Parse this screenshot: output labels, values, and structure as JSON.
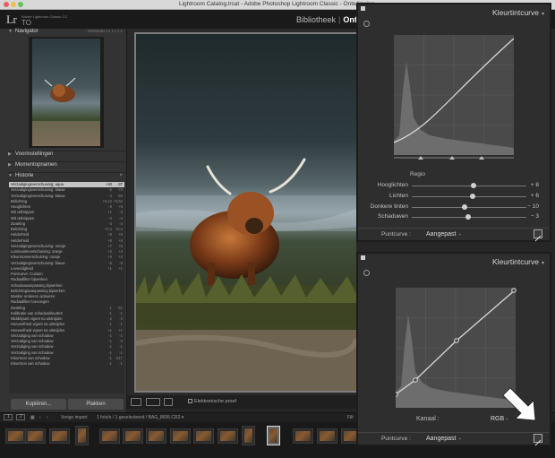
{
  "window": {
    "title": "Lightroom Catalog.lrcat - Adobe Photoshop Lightroom Classic - Ontwikkelen"
  },
  "identity": {
    "logo": "Lr",
    "subtitle": "Adobe Lightroom Classic CC",
    "user": "TO"
  },
  "modules": {
    "library": "Bibliotheek",
    "separator": "|",
    "active": "Ont"
  },
  "left_panel": {
    "navigator": {
      "title": "Navigator",
      "options": "PASSEND  1:1  1:1  1:1"
    },
    "presets": {
      "title": "Voorinstellingen"
    },
    "snapshots": {
      "title": "Momentopnamen"
    },
    "history": {
      "title": "Historie",
      "items": [
        {
          "label": "Verzadigingsverschuiving: aqua",
          "v1": "+40",
          "v2": "-37",
          "selected": true
        },
        {
          "label": "Verzadigingsverschuiving: blauw",
          "v1": "-5",
          "v2": "-73"
        },
        {
          "label": "Verzadigingsverschuiving: blauw",
          "v1": "-4",
          "v2": "-69"
        },
        {
          "label": "Belichting",
          "v1": "+0,12",
          "v2": "+0,52"
        },
        {
          "label": "Hooglichten",
          "v1": "-9",
          "v2": "+8"
        },
        {
          "label": "Wit uitknippen",
          "v1": "+1",
          "v2": "-3"
        },
        {
          "label": "Wit uitknippen",
          "v1": "-4",
          "v2": "-4"
        },
        {
          "label": "Zwarting",
          "v1": "-4",
          "v2": "-4"
        },
        {
          "label": "Belichting",
          "v1": "+0,4",
          "v2": "+0,4"
        },
        {
          "label": "Helderheid",
          "v1": "+8",
          "v2": "+8"
        },
        {
          "label": "Helderheid",
          "v1": "+8",
          "v2": "+8"
        },
        {
          "label": "Verzadigingsverschuiving: oranje",
          "v1": "+7",
          "v2": "+5"
        },
        {
          "label": "Luminantieverschuiving: oranje",
          "v1": "+2",
          "v2": "+4"
        },
        {
          "label": "Kleurtoonverschuiving: oranje",
          "v1": "+5",
          "v2": "+2"
        },
        {
          "label": "Verzadigingsverschuiving: blauw",
          "v1": "-5",
          "v2": "-8"
        },
        {
          "label": "Levendigheid",
          "v1": "+1",
          "v2": "+1"
        },
        {
          "label": "Puntcurve: Custom",
          "v1": "",
          "v2": ""
        },
        {
          "label": "Radiaalfilter bijwerken",
          "v1": "",
          "v2": ""
        },
        {
          "label": "Schaduwaanpassing bijwerken",
          "v1": "",
          "v2": ""
        },
        {
          "label": "Belichtingsaanpassing bijwerken",
          "v1": "",
          "v2": ""
        },
        {
          "label": "Masker omkeren activeren",
          "v1": "",
          "v2": ""
        },
        {
          "label": "Radiaalfilter toevoegen",
          "v1": "",
          "v2": ""
        },
        {
          "label": "Zwarting",
          "v1": "-1",
          "v2": "-61"
        },
        {
          "label": "Kalibratie van schaduwkleurtint",
          "v1": "-1",
          "v2": "-1"
        },
        {
          "label": "Middelpunt vignet na uitsnijden",
          "v1": "-2",
          "v2": "-3"
        },
        {
          "label": "Hoeveelheid vignet na uitsnijden",
          "v1": "-1",
          "v2": "-1"
        },
        {
          "label": "Hoeveelheid vignet na uitsnijden",
          "v1": "+1",
          "v2": "+1"
        },
        {
          "label": "Verzadiging van schaduw",
          "v1": "-1",
          "v2": "-2"
        },
        {
          "label": "Verzadiging van schaduw",
          "v1": "-1",
          "v2": "-3"
        },
        {
          "label": "Verzadiging van schaduw",
          "v1": "-1",
          "v2": "-1"
        },
        {
          "label": "Verzadiging van schaduw",
          "v1": "-1",
          "v2": "-1"
        },
        {
          "label": "Kleurtoon van schaduw",
          "v1": "-1",
          "v2": "-217"
        },
        {
          "label": "Kleurtoon van schaduw",
          "v1": "-1",
          "v2": "-1"
        }
      ]
    },
    "copy_label": "Kopiëren...",
    "paste_label": "Plakken"
  },
  "toolbar": {
    "softproof_label": "Elektronische proef"
  },
  "filmstrip_bar": {
    "page1": "1",
    "page2": "2",
    "prev_label": "Vorige import",
    "info": "1 foto/s / 1 geselecteerd / BAG_8695.CR2",
    "info_arrow": "▾",
    "filter_label": "Filt"
  },
  "curve_top": {
    "title": "Kleurtintcurve",
    "title_arrow": "▾",
    "region_title": "Regio",
    "sliders": [
      {
        "label": "Hooglichten",
        "value": "+ 8",
        "position": 0.54
      },
      {
        "label": "Lichten",
        "value": "+ 6",
        "position": 0.53
      },
      {
        "label": "Donkere tinten",
        "value": "− 10",
        "position": 0.46
      },
      {
        "label": "Schaduwen",
        "value": "− 3",
        "position": 0.49
      }
    ],
    "pointcurve_label": "Puntcurve :",
    "pointcurve_value": "Aangepast",
    "pointcurve_arrow": "÷"
  },
  "curve_bottom": {
    "title": "Kleurtintcurve",
    "title_arrow": "▾",
    "channel_label": "Kanaal :",
    "channel_value": "RGB",
    "channel_arrow": "÷",
    "pointcurve_label": "Puntcurve :",
    "pointcurve_value": "Aangepast",
    "pointcurve_arrow": "÷"
  },
  "colors": {
    "accent_arrow": "#ffffff",
    "panel_bg": "#2e2e2e"
  }
}
